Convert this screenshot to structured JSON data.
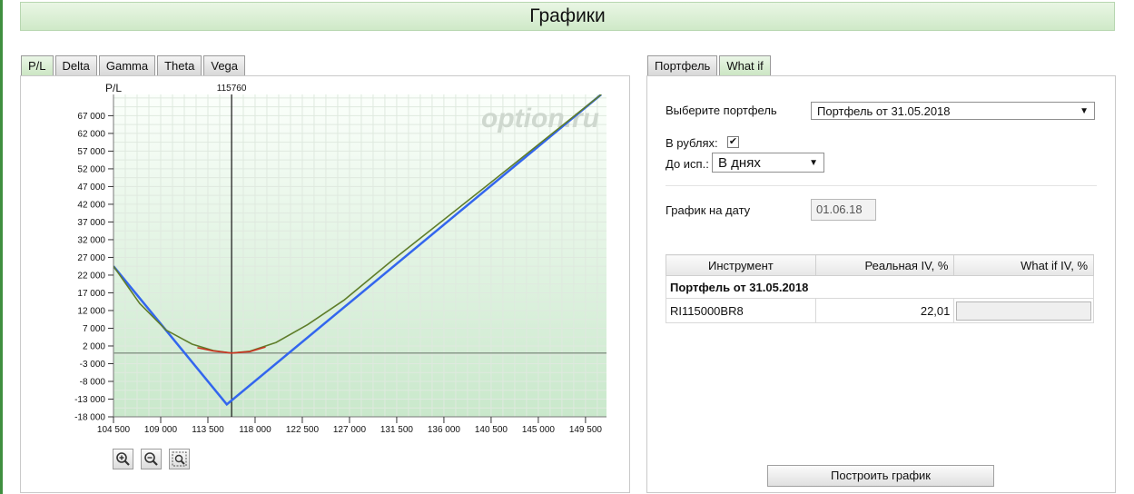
{
  "page_title": "Графики",
  "chart_tabs": [
    "P/L",
    "Delta",
    "Gamma",
    "Theta",
    "Vega"
  ],
  "side_tabs": [
    "Портфель",
    "What if"
  ],
  "chart": {
    "y_axis_title": "P/L",
    "marker_label": "115760",
    "watermark": "option.ru",
    "zoom_buttons": [
      "zoom-in-icon",
      "zoom-out-icon",
      "zoom-fit-icon"
    ]
  },
  "chart_data": {
    "type": "line",
    "ylabel": "P/L",
    "xlim": [
      104500,
      151500
    ],
    "ylim": [
      -18000,
      73000
    ],
    "x_ticks": [
      "104 500",
      "109 000",
      "113 500",
      "118 000",
      "122 500",
      "127 000",
      "131 500",
      "136 000",
      "140 500",
      "145 000",
      "149 500"
    ],
    "y_ticks": [
      "67 000",
      "62 000",
      "57 000",
      "52 000",
      "47 000",
      "42 000",
      "37 000",
      "32 000",
      "27 000",
      "22 000",
      "17 000",
      "12 000",
      "7 000",
      "2 000",
      "-3 000",
      "-8 000",
      "-13 000",
      "-18 000"
    ],
    "marker_x": 115760,
    "zero_line": 0,
    "series": [
      {
        "color": "#3366ee",
        "points": [
          [
            104500,
            24500
          ],
          [
            115300,
            -14500
          ],
          [
            151000,
            73000
          ]
        ]
      },
      {
        "color": "#5f7d2a",
        "points": [
          [
            104500,
            24500
          ],
          [
            107000,
            14000
          ],
          [
            109500,
            6500
          ],
          [
            112000,
            2500
          ],
          [
            114000,
            700
          ],
          [
            115760,
            0
          ],
          [
            117500,
            500
          ],
          [
            120000,
            3000
          ],
          [
            123000,
            8000
          ],
          [
            126500,
            15000
          ],
          [
            131000,
            26000
          ],
          [
            140000,
            47000
          ],
          [
            151000,
            73000
          ]
        ]
      },
      {
        "color": "#cc3322",
        "points": [
          [
            112500,
            1500
          ],
          [
            114000,
            600
          ],
          [
            115760,
            0
          ],
          [
            117500,
            400
          ],
          [
            119000,
            1700
          ]
        ]
      }
    ]
  },
  "form": {
    "portfolio_label": "Выберите портфель",
    "portfolio_value": "Портфель от 31.05.2018",
    "rubles_label": "В рублях:",
    "rubles_checked": "✔",
    "expiry_label": "До исп.:",
    "expiry_value": "В днях",
    "chart_date_label": "График на дату",
    "chart_date_value": "01.06.18"
  },
  "table": {
    "headers": [
      "Инструмент",
      "Реальная IV, %",
      "What if IV, %"
    ],
    "group": "Портфель от 31.05.2018",
    "rows": [
      {
        "instrument": "RI115000BR8",
        "real_iv": "22,01",
        "whatif_iv": ""
      }
    ]
  },
  "build_button": "Построить график"
}
